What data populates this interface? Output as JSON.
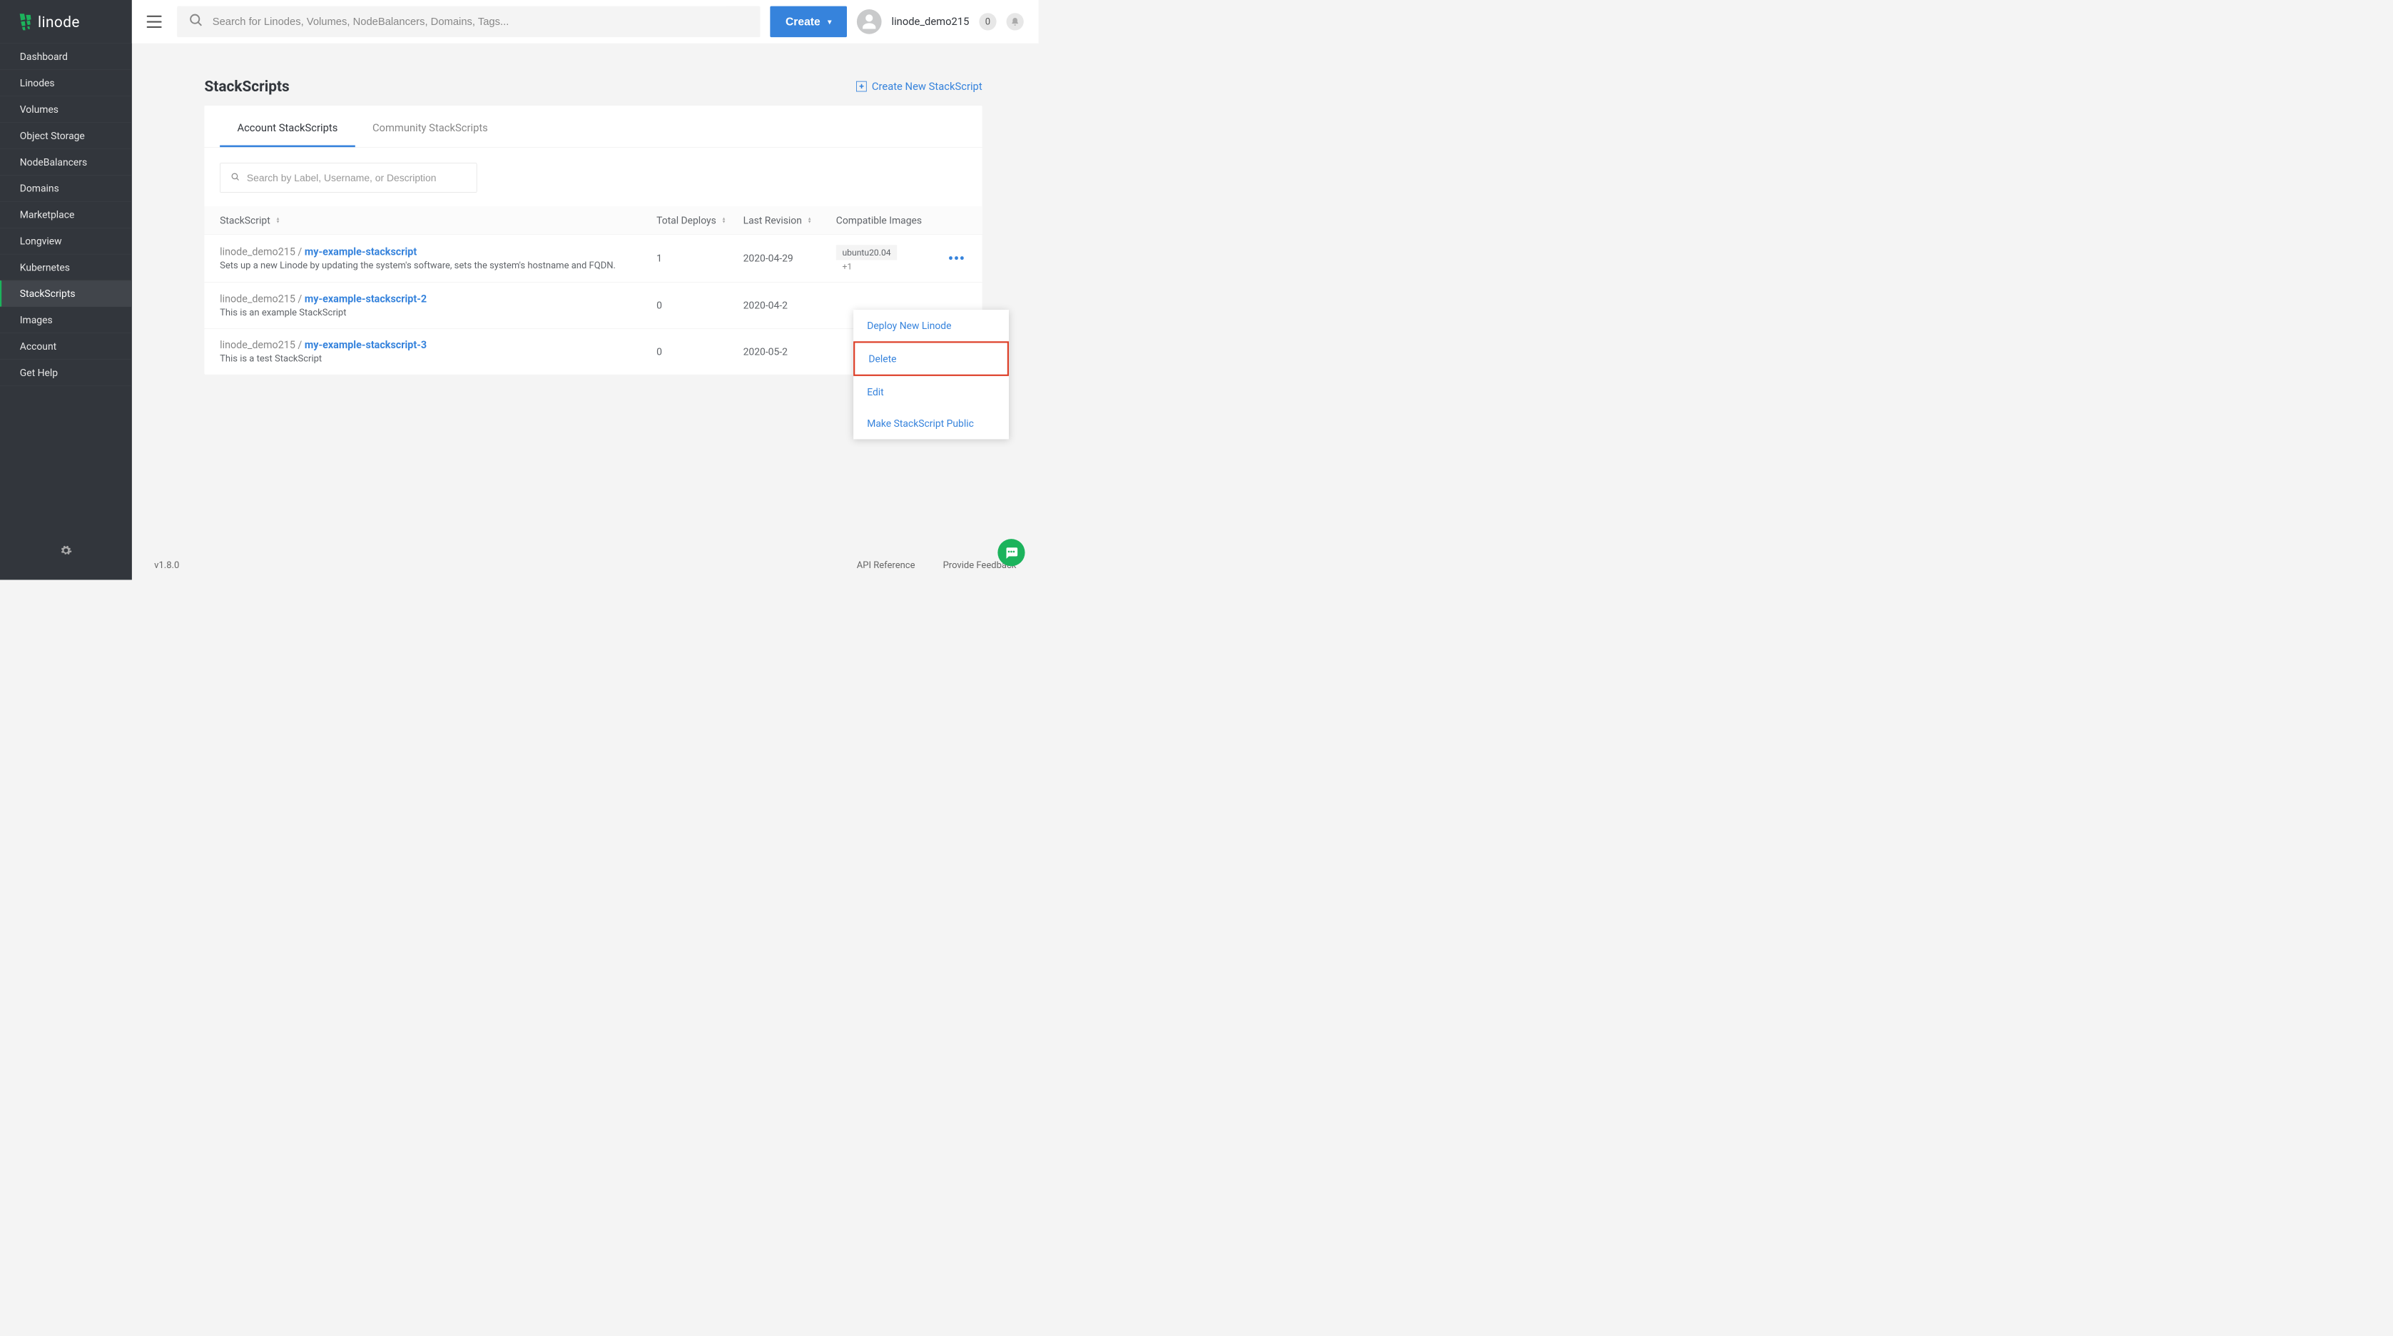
{
  "brand": {
    "name": "linode"
  },
  "sidebar": {
    "items": [
      {
        "label": "Dashboard",
        "active": false
      },
      {
        "label": "Linodes",
        "active": false
      },
      {
        "label": "Volumes",
        "active": false
      },
      {
        "label": "Object Storage",
        "active": false
      },
      {
        "label": "NodeBalancers",
        "active": false
      },
      {
        "label": "Domains",
        "active": false
      },
      {
        "label": "Marketplace",
        "active": false
      },
      {
        "label": "Longview",
        "active": false
      },
      {
        "label": "Kubernetes",
        "active": false
      },
      {
        "label": "StackScripts",
        "active": true
      },
      {
        "label": "Images",
        "active": false
      },
      {
        "label": "Account",
        "active": false
      },
      {
        "label": "Get Help",
        "active": false
      }
    ]
  },
  "topbar": {
    "search_placeholder": "Search for Linodes, Volumes, NodeBalancers, Domains, Tags...",
    "create_label": "Create",
    "username": "linode_demo215",
    "notification_count": "0"
  },
  "page": {
    "title": "StackScripts",
    "create_link": "Create New StackScript",
    "tabs": [
      {
        "label": "Account StackScripts",
        "active": true
      },
      {
        "label": "Community StackScripts",
        "active": false
      }
    ],
    "filter_placeholder": "Search by Label, Username, or Description",
    "columns": {
      "stackscript": "StackScript",
      "deploys": "Total Deploys",
      "revision": "Last Revision",
      "images": "Compatible Images"
    },
    "rows": [
      {
        "user": "linode_demo215",
        "label": "my-example-stackscript",
        "desc": "Sets up a new Linode by updating the system's software, sets the system's hostname and FQDN.",
        "deploys": "1",
        "revision": "2020-04-29",
        "image": "ubuntu20.04",
        "more": "+1",
        "menu_open": true
      },
      {
        "user": "linode_demo215",
        "label": "my-example-stackscript-2",
        "desc": "This is an example StackScript",
        "deploys": "0",
        "revision": "2020-04-2",
        "image": "",
        "more": "",
        "menu_open": false
      },
      {
        "user": "linode_demo215",
        "label": "my-example-stackscript-3",
        "desc": "This is a test StackScript",
        "deploys": "0",
        "revision": "2020-05-2",
        "image": "",
        "more": "",
        "menu_open": false
      }
    ],
    "action_menu": {
      "deploy": "Deploy New Linode",
      "delete": "Delete",
      "edit": "Edit",
      "public": "Make StackScript Public"
    }
  },
  "footer": {
    "version": "v1.8.0",
    "api_ref": "API Reference",
    "feedback": "Provide Feedback"
  }
}
